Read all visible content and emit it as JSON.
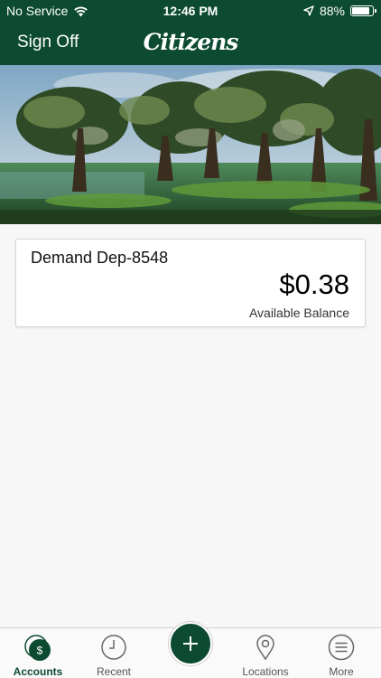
{
  "status_bar": {
    "carrier": "No Service",
    "time": "12:46 PM",
    "battery": "88%",
    "battery_level": 0.88,
    "icons": [
      "wifi-icon",
      "location-arrow-icon",
      "battery-icon"
    ]
  },
  "header": {
    "sign_off_label": "Sign Off",
    "logo_text": "Citizens"
  },
  "accounts": [
    {
      "name": "Demand Dep-8548",
      "balance": "$0.38",
      "balance_label": "Available Balance"
    }
  ],
  "tabs": [
    {
      "label": "Accounts",
      "icon": "dollar-icon",
      "active": true
    },
    {
      "label": "Recent",
      "icon": "clock-icon",
      "active": false
    },
    {
      "label": "",
      "icon": "plus-icon",
      "active": false
    },
    {
      "label": "Locations",
      "icon": "location-pin-icon",
      "active": false
    },
    {
      "label": "More",
      "icon": "menu-icon",
      "active": false
    }
  ],
  "fab_symbol": "+",
  "accounts_icon_symbol": "$",
  "colors": {
    "brand_green": "#0c4a31",
    "background": "#f7f7f7"
  }
}
